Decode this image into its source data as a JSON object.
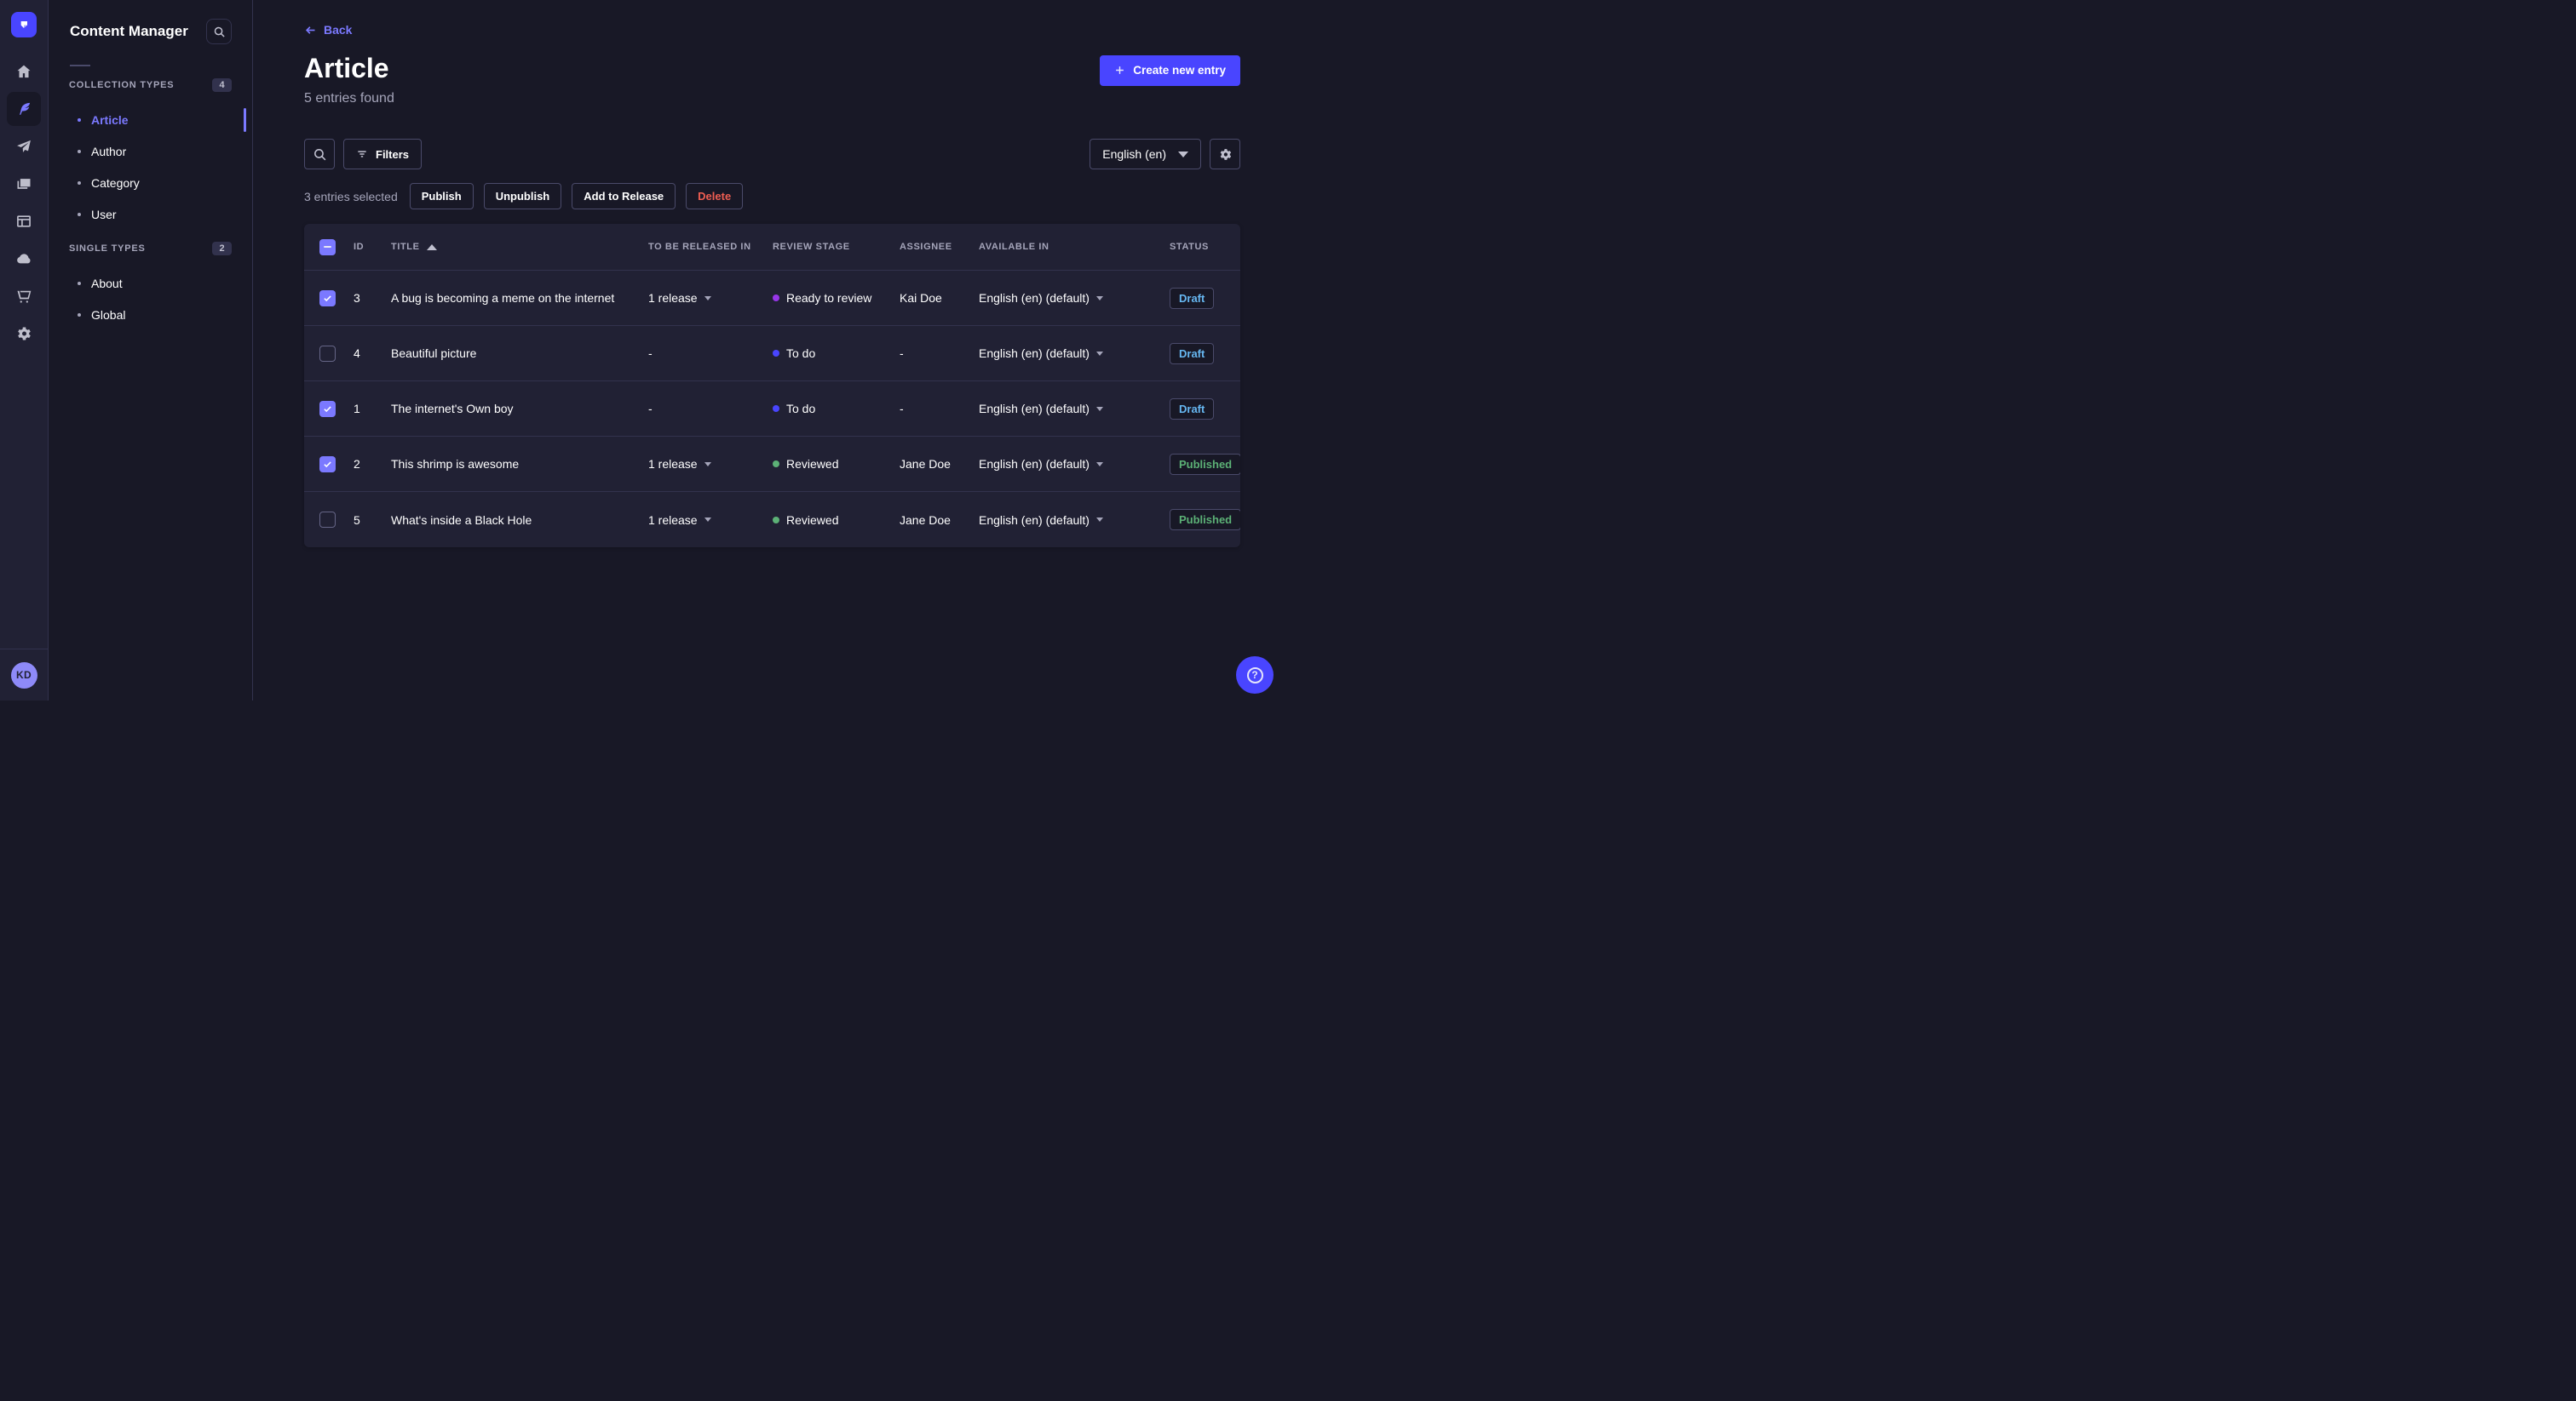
{
  "nav_rail": {
    "avatar_initials": "KD",
    "items": [
      {
        "icon": "home-icon",
        "active": false
      },
      {
        "icon": "content-manager-icon",
        "active": true
      },
      {
        "icon": "releases-icon",
        "active": false
      },
      {
        "icon": "media-library-icon",
        "active": false
      },
      {
        "icon": "content-type-builder-icon",
        "active": false
      },
      {
        "icon": "deploy-cloud-icon",
        "active": false
      },
      {
        "icon": "marketplace-icon",
        "active": false
      },
      {
        "icon": "settings-icon",
        "active": false
      }
    ]
  },
  "sidebar": {
    "title": "Content Manager",
    "sections": [
      {
        "label": "COLLECTION TYPES",
        "count": "4",
        "items": [
          {
            "label": "Article",
            "active": true
          },
          {
            "label": "Author",
            "active": false
          },
          {
            "label": "Category",
            "active": false
          },
          {
            "label": "User",
            "active": false
          }
        ]
      },
      {
        "label": "SINGLE TYPES",
        "count": "2",
        "items": [
          {
            "label": "About",
            "active": false
          },
          {
            "label": "Global",
            "active": false
          }
        ]
      }
    ]
  },
  "header": {
    "back_label": "Back",
    "title": "Article",
    "subtitle": "5 entries found",
    "create_label": "Create new entry"
  },
  "toolbar": {
    "filters_label": "Filters",
    "locale": "English (en)"
  },
  "selection": {
    "text": "3 entries selected",
    "publish_label": "Publish",
    "unpublish_label": "Unpublish",
    "add_to_release_label": "Add to Release",
    "delete_label": "Delete"
  },
  "table": {
    "headers": {
      "id": "ID",
      "title": "TITLE",
      "release": "TO BE RELEASED IN",
      "stage": "REVIEW STAGE",
      "assignee": "ASSIGNEE",
      "available": "AVAILABLE IN",
      "status": "STATUS"
    },
    "sort": {
      "column": "TITLE",
      "direction": "asc"
    },
    "header_checkbox_state": "indeterminate",
    "rows": [
      {
        "checked": true,
        "id": "3",
        "title": "A bug is becoming a meme on the internet",
        "release": "1 release",
        "stage": "Ready to review",
        "stage_color": "purple",
        "assignee": "Kai Doe",
        "available": "English (en) (default)",
        "status": "Draft"
      },
      {
        "checked": false,
        "id": "4",
        "title": "Beautiful picture",
        "release": "-",
        "stage": "To do",
        "stage_color": "blue",
        "assignee": "-",
        "available": "English (en) (default)",
        "status": "Draft"
      },
      {
        "checked": true,
        "id": "1",
        "title": "The internet's Own boy",
        "release": "-",
        "stage": "To do",
        "stage_color": "blue",
        "assignee": "-",
        "available": "English (en) (default)",
        "status": "Draft"
      },
      {
        "checked": true,
        "id": "2",
        "title": "This shrimp is awesome",
        "release": "1 release",
        "stage": "Reviewed",
        "stage_color": "green",
        "assignee": "Jane Doe",
        "available": "English (en) (default)",
        "status": "Published"
      },
      {
        "checked": false,
        "id": "5",
        "title": "What's inside a Black Hole",
        "release": "1 release",
        "stage": "Reviewed",
        "stage_color": "green",
        "assignee": "Jane Doe",
        "available": "English (en) (default)",
        "status": "Published"
      }
    ]
  },
  "colors": {
    "primary": "#4945FF",
    "primary_light": "#7B79FF",
    "danger": "#EE5E52",
    "status_draft": "#66B7F1",
    "status_published": "#5CB176",
    "stage_purple": "#9736E8",
    "stage_blue": "#4945FF",
    "stage_green": "#5CB176"
  }
}
